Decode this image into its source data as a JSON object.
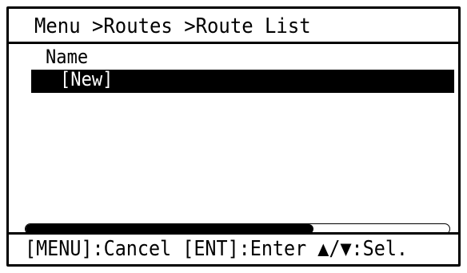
{
  "title_bar": {
    "breadcrumb": "Menu >Routes >Route List"
  },
  "list": {
    "column_header": "Name",
    "items": [
      {
        "label": "[New]",
        "selected": true
      }
    ]
  },
  "scrollbar": {
    "thumb_fraction": 0.68
  },
  "footer": {
    "hint": "[MENU]:Cancel [ENT]:Enter ▲/▼:Sel."
  },
  "colors": {
    "foreground": "#000000",
    "background": "#ffffff",
    "selected_bg": "#000000",
    "selected_fg": "#ffffff"
  }
}
